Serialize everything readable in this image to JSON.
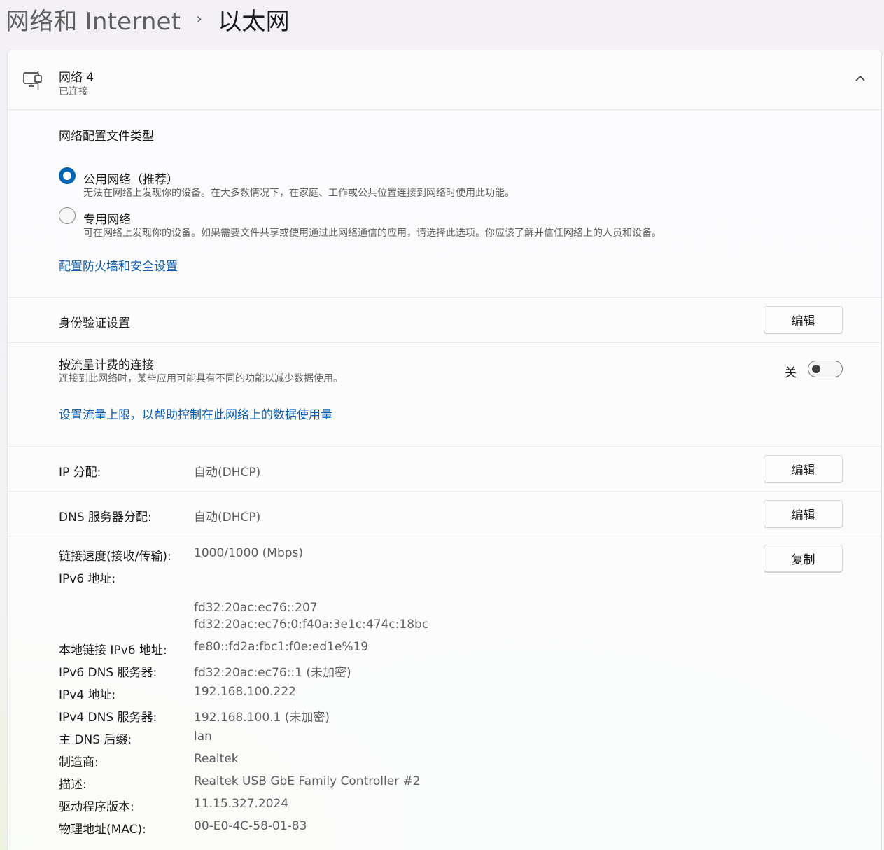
{
  "breadcrumb": {
    "parent": "网络和 Internet",
    "separator": "›",
    "current": "以太网"
  },
  "network": {
    "name": "网络 4",
    "status": "已连接",
    "icon": "ethernet-computer-icon"
  },
  "profile": {
    "heading": "网络配置文件类型",
    "options": [
      {
        "label": "公用网络（推荐）",
        "description": "无法在网络上发现你的设备。在大多数情况下，在家庭、工作或公共位置连接到网络时使用此功能。",
        "selected": true
      },
      {
        "label": "专用网络",
        "description": "可在网络上发现你的设备。如果需要文件共享或使用通过此网络通信的应用，请选择此选项。你应该了解并信任网络上的人员和设备。",
        "selected": false
      }
    ],
    "firewall_link": "配置防火墙和安全设置"
  },
  "auth": {
    "label": "身份验证设置",
    "button": "编辑"
  },
  "metered": {
    "label": "按流量计费的连接",
    "description": "连接到此网络时，某些应用可能具有不同的功能以减少数据使用。",
    "toggle_state_label": "关",
    "toggle_on": false,
    "data_limit_link": "设置流量上限，以帮助控制在此网络上的数据使用量"
  },
  "ip_assignment": {
    "label": "IP 分配:",
    "value": "自动(DHCP)",
    "button": "编辑"
  },
  "dns_assignment": {
    "label": "DNS 服务器分配:",
    "value": "自动(DHCP)",
    "button": "编辑"
  },
  "properties": {
    "copy_button": "复制",
    "link_speed_label": "链接速度(接收/传输):",
    "link_speed_value": "1000/1000 (Mbps)",
    "ipv6_label": "IPv6 地址:",
    "ipv6_values": [
      "fd32:20ac:ec76::207",
      "fd32:20ac:ec76:0:f40a:3e1c:474c:18bc"
    ],
    "rows": [
      {
        "label": "本地链接 IPv6 地址:",
        "value": "fe80::fd2a:fbc1:f0e:ed1e%19"
      },
      {
        "label": "IPv6 DNS 服务器:",
        "value": "fd32:20ac:ec76::1 (未加密)"
      },
      {
        "label": "IPv4 地址:",
        "value": "192.168.100.222"
      },
      {
        "label": "IPv4 DNS 服务器:",
        "value": "192.168.100.1 (未加密)"
      },
      {
        "label": "主 DNS 后缀:",
        "value": "lan"
      },
      {
        "label": "制造商:",
        "value": "Realtek"
      },
      {
        "label": "描述:",
        "value": "Realtek USB GbE Family Controller #2"
      },
      {
        "label": "驱动程序版本:",
        "value": "11.15.327.2024"
      },
      {
        "label": "物理地址(MAC):",
        "value": "00-E0-4C-58-01-83"
      }
    ]
  },
  "colors": {
    "accent": "#0063b1",
    "link": "#0b5cad",
    "secondary_text": "#5f5f5f"
  }
}
